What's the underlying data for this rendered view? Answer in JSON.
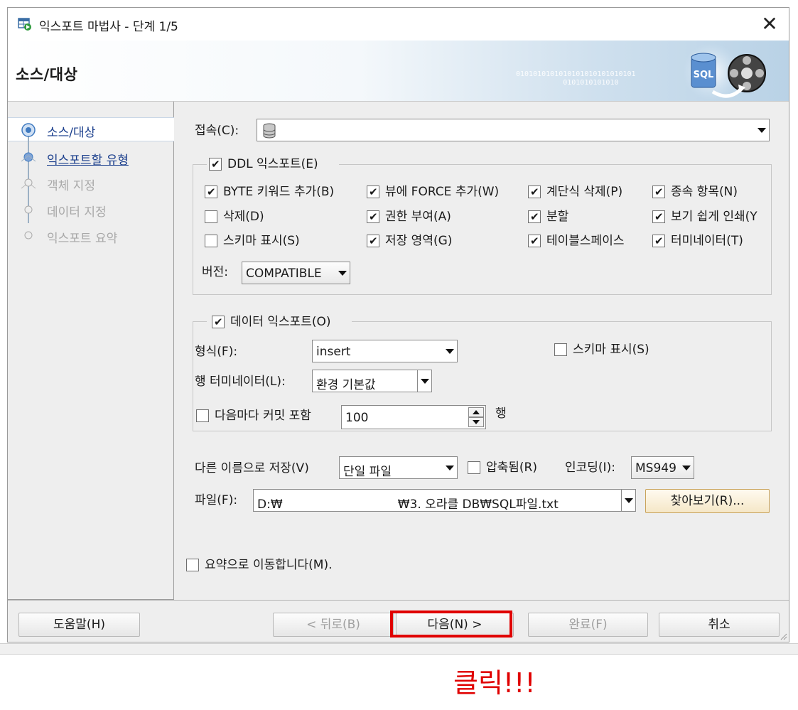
{
  "window": {
    "title": "익스포트 마법사 - 단계 1/5",
    "close_glyph": "✕"
  },
  "header": {
    "title": "소스/대상",
    "binary": "0101010101010101010101010101\n           0101010101010",
    "badge": "SQL"
  },
  "steps": [
    {
      "label": "소스/대상",
      "state": "active"
    },
    {
      "label": "익스포트할 유형",
      "state": "link"
    },
    {
      "label": "객체 지정",
      "state": "disabled"
    },
    {
      "label": "데이터 지정",
      "state": "disabled"
    },
    {
      "label": "익스포트 요약",
      "state": "disabled"
    }
  ],
  "connection": {
    "label": "접속(C):",
    "value": ""
  },
  "ddl": {
    "label": "DDL 익스포트(E)",
    "checked": true,
    "options": [
      {
        "label": "BYTE 키워드 추가(B)",
        "checked": true
      },
      {
        "label": "뷰에 FORCE 추가(W)",
        "checked": true
      },
      {
        "label": "계단식 삭제(P)",
        "checked": true
      },
      {
        "label": "종속 항목(N)",
        "checked": true
      },
      {
        "label": "삭제(D)",
        "checked": false
      },
      {
        "label": "권한 부여(A)",
        "checked": true
      },
      {
        "label": "분할",
        "checked": true
      },
      {
        "label": "보기 쉽게 인쇄(Y",
        "checked": true
      },
      {
        "label": "스키마 표시(S)",
        "checked": false
      },
      {
        "label": "저장 영역(G)",
        "checked": true
      },
      {
        "label": "테이블스페이스",
        "checked": true
      },
      {
        "label": "터미네이터(T)",
        "checked": true
      }
    ],
    "version_label": "버전:",
    "version_value": "COMPATIBLE"
  },
  "data_export": {
    "label": "데이터 익스포트(O)",
    "checked": true,
    "format_label": "형식(F):",
    "format_value": "insert",
    "schema_label": "스키마 표시(S)",
    "schema_checked": false,
    "terminator_label": "행 터미네이터(L):",
    "terminator_value": "환경 기본값",
    "commit_label": "다음마다 커밋 포함",
    "commit_checked": false,
    "commit_value": "100",
    "commit_unit": "행"
  },
  "save": {
    "label": "다른 이름으로 저장(V)",
    "value": "단일 파일",
    "compress_label": "압축됨(R)",
    "compress_checked": false,
    "encoding_label": "인코딩(I):",
    "encoding_value": "MS949",
    "file_label": "파일(F):",
    "file_value": "D:₩                              ₩3. 오라클 DB₩SQL파일.txt",
    "browse_label": "찾아보기(R)..."
  },
  "summary_jump": {
    "label": "요약으로 이동합니다(M).",
    "checked": false
  },
  "buttons": {
    "help": "도움말(H)",
    "back": "< 뒤로(B)",
    "next": "다음(N) >",
    "finish": "완료(F)",
    "cancel": "취소"
  },
  "annotation": {
    "text": "클릭!!!",
    "color": "#e00000"
  }
}
